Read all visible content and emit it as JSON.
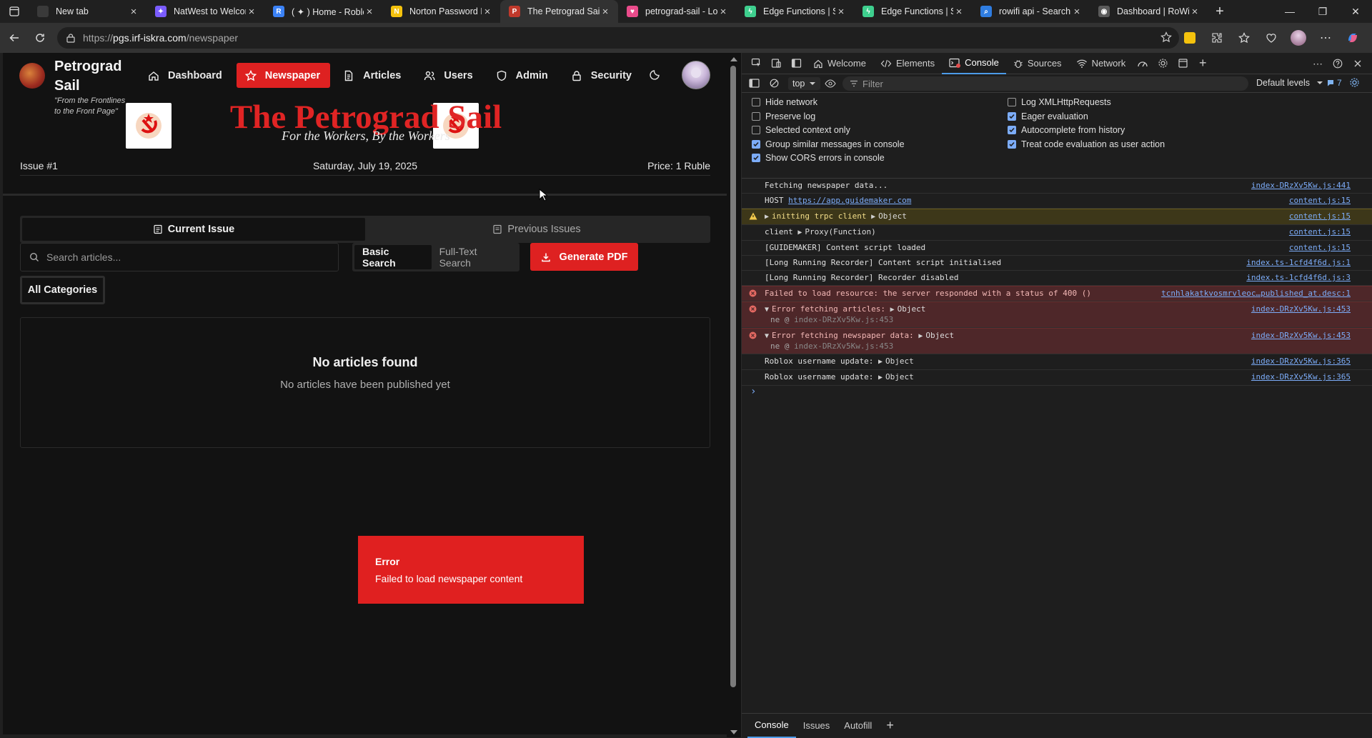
{
  "browser": {
    "tabs": [
      {
        "title": "New tab",
        "icon": "new-tab-icon",
        "color": "#3a3a3a",
        "active": false
      },
      {
        "title": "NatWest to Welcome",
        "icon": "copilot-icon",
        "color": "#7a5cff",
        "active": false
      },
      {
        "title": "( ✦ ) Home - Roblox",
        "icon": "roblox-icon",
        "color": "#3b82f6",
        "active": false
      },
      {
        "title": "Norton Password Manager",
        "icon": "norton-icon",
        "color": "#f4c20d",
        "active": false
      },
      {
        "title": "The Petrograd Sail",
        "icon": "petrograd-icon",
        "color": "#c0392b",
        "active": true
      },
      {
        "title": "petrograd-sail - Lovable",
        "icon": "lovable-icon",
        "color": "#e94b8a",
        "active": false
      },
      {
        "title": "Edge Functions | Supabase",
        "icon": "supabase-icon",
        "color": "#3ecf8e",
        "active": false
      },
      {
        "title": "Edge Functions | Supabase",
        "icon": "supabase-icon",
        "color": "#3ecf8e",
        "active": false
      },
      {
        "title": "rowifi api - Search",
        "icon": "search-icon",
        "color": "#2f7de1",
        "active": false
      },
      {
        "title": "Dashboard | RoWifi",
        "icon": "rowifi-icon",
        "color": "#5a5a5a",
        "active": false
      }
    ],
    "address": {
      "prefix": "https://",
      "host": "pgs.irf-iskra.com",
      "path": "/newspaper"
    }
  },
  "site": {
    "brand": "Petrograd Sail",
    "tagline_1": "\"From the Frontlines",
    "tagline_2": "to the Front Page\"",
    "nav": [
      {
        "label": "Dashboard",
        "icon": "home-icon",
        "active": false
      },
      {
        "label": "Newspaper",
        "icon": "star-icon",
        "active": true
      },
      {
        "label": "Articles",
        "icon": "document-icon",
        "active": false
      },
      {
        "label": "Users",
        "icon": "users-icon",
        "active": false
      },
      {
        "label": "Admin",
        "icon": "shield-icon",
        "active": false
      },
      {
        "label": "Security",
        "icon": "lock-icon",
        "active": false
      }
    ],
    "masthead": {
      "title": "The Petrograd Sail",
      "subtitle": "For the Workers, By the Workers",
      "issue": "Issue #1",
      "date": "Saturday, July 19, 2025",
      "price": "Price: 1 Ruble"
    },
    "tabs": {
      "current": "Current Issue",
      "previous": "Previous Issues"
    },
    "search": {
      "placeholder": "Search articles...",
      "value": ""
    },
    "search_modes": {
      "basic": "Basic Search",
      "fulltext": "Full-Text Search"
    },
    "generate_pdf": "Generate PDF",
    "category_filter": "All Categories",
    "empty": {
      "title": "No articles found",
      "message": "No articles have been published yet"
    },
    "toast": {
      "title": "Error",
      "message": "Failed to load newspaper content"
    },
    "accent_color": "#de2121"
  },
  "devtools": {
    "tabs": {
      "welcome": "Welcome",
      "elements": "Elements",
      "console": "Console",
      "sources": "Sources",
      "network": "Network"
    },
    "context": "top",
    "filter_placeholder": "Filter",
    "levels": "Default levels",
    "issues_count": "7",
    "settings": [
      {
        "label": "Hide network",
        "checked": false
      },
      {
        "label": "Preserve log",
        "checked": false
      },
      {
        "label": "Selected context only",
        "checked": false
      },
      {
        "label": "Group similar messages in console",
        "checked": true
      },
      {
        "label": "Show CORS errors in console",
        "checked": true
      },
      {
        "label": "Log XMLHttpRequests",
        "checked": false
      },
      {
        "label": "Eager evaluation",
        "checked": true
      },
      {
        "label": "Autocomplete from history",
        "checked": true
      },
      {
        "label": "Treat code evaluation as user action",
        "checked": true
      }
    ],
    "log": [
      {
        "level": "info",
        "text": "Fetching newspaper data...",
        "src": "index-DRzXv5Kw.js:441"
      },
      {
        "level": "info",
        "text": "HOST ",
        "link": "https://app.guidemaker.com",
        "src": "content.js:15"
      },
      {
        "level": "warn",
        "text": "initting trpc client",
        "obj": "Object",
        "src": "content.js:15"
      },
      {
        "level": "info",
        "text": "client ",
        "obj": "Proxy(Function)",
        "src": "content.js:15"
      },
      {
        "level": "info",
        "text": "[GUIDEMAKER] Content script loaded",
        "src": "content.js:15"
      },
      {
        "level": "info",
        "text": "[Long Running Recorder] Content script initialised",
        "src": "index.ts-1cfd4f6d.js:1"
      },
      {
        "level": "info",
        "text": "[Long Running Recorder] Recorder disabled",
        "src": "index.ts-1cfd4f6d.js:3"
      },
      {
        "level": "error",
        "text": "Failed to load resource: the server responded with a status of 400 ()",
        "src": "tcnhlakatkvosmrvleoc…published_at.desc:1"
      },
      {
        "level": "error",
        "text": "Error fetching articles:",
        "obj": "Object",
        "stack": "ne @ ",
        "stack_link": "index-DRzXv5Kw.js:453",
        "src": "index-DRzXv5Kw.js:453"
      },
      {
        "level": "error",
        "text": "Error fetching newspaper data:",
        "obj": "Object",
        "stack": "ne @ ",
        "stack_link": "index-DRzXv5Kw.js:453",
        "src": "index-DRzXv5Kw.js:453"
      },
      {
        "level": "info",
        "text": "Roblox username update:",
        "obj": "Object",
        "src": "index-DRzXv5Kw.js:365"
      },
      {
        "level": "info",
        "text": "Roblox username update:",
        "obj": "Object",
        "src": "index-DRzXv5Kw.js:365"
      }
    ],
    "drawer_tabs": {
      "console": "Console",
      "issues": "Issues",
      "autofill": "Autofill"
    }
  }
}
